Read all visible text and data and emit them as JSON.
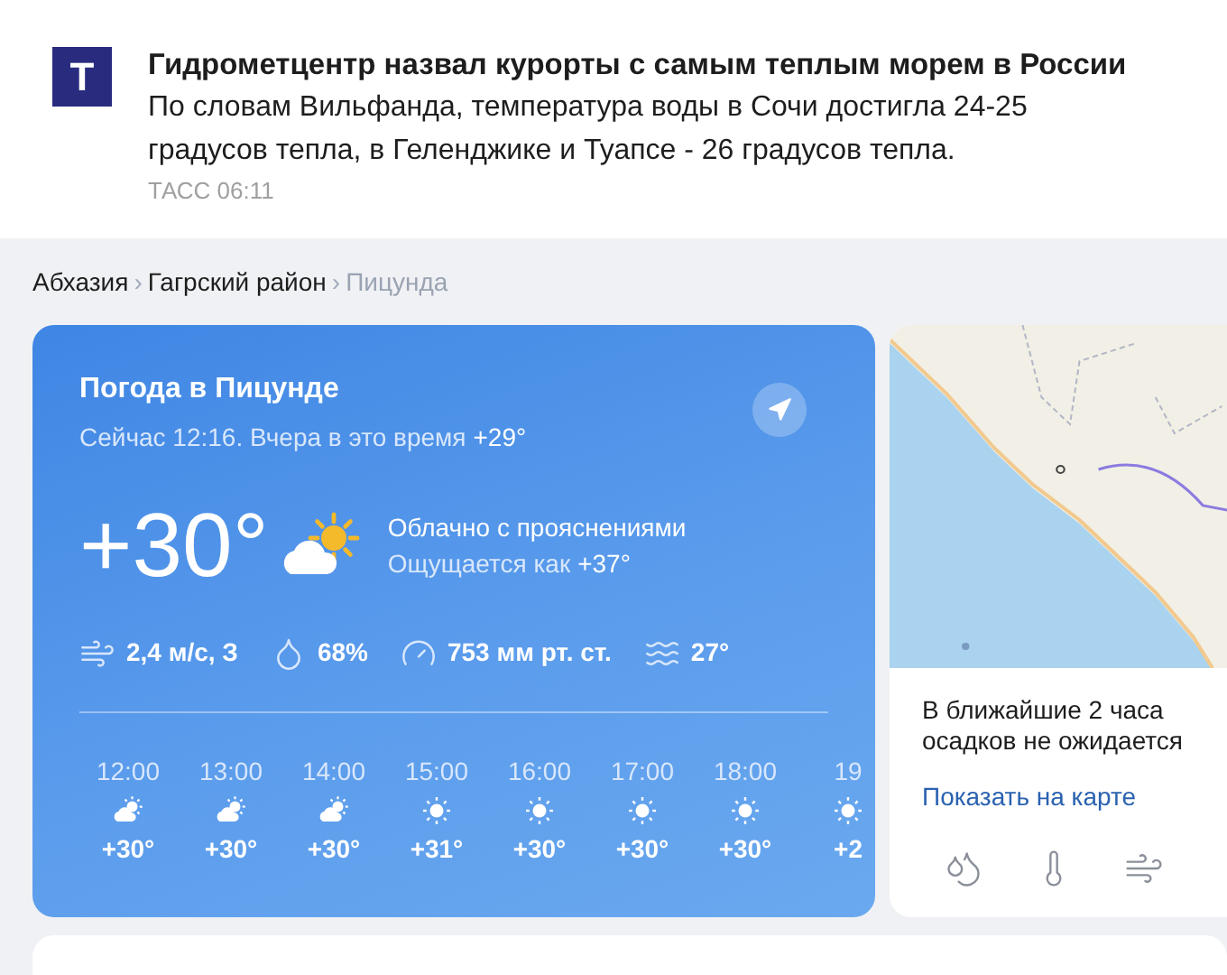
{
  "news": {
    "logo": "Т",
    "title": "Гидрометцентр назвал курорты с самым теплым морем в России",
    "text": "По словам Вильфанда, температура воды в Сочи достигла 24-25 градусов тепла, в Геленджике и Туапсе - 26 градусов тепла.",
    "source": "ТАСС 06:11"
  },
  "breadcrumbs": [
    {
      "label": "Абхазия",
      "current": false
    },
    {
      "separator": "›",
      "label": "Гагрский район",
      "current": false
    },
    {
      "separator": "›",
      "label": "Пицунда",
      "current": true
    }
  ],
  "weather": {
    "title": "Погода в Пицунде",
    "now": "Сейчас 12:16. Вчера в это время",
    "yesterday": "+29°",
    "temp": "+30°",
    "condition": "Облачно с прояснениями",
    "feels_label": "Ощущается как",
    "feels": "+37°",
    "details": [
      {
        "kind": "wind",
        "text": "2,4 м/с, З"
      },
      {
        "kind": "humidity",
        "text": "68%"
      },
      {
        "kind": "pressure",
        "text": "753 мм рт. ст."
      },
      {
        "kind": "water",
        "text": "27°"
      }
    ],
    "hourly": [
      {
        "time": "12:00",
        "kind": "partly",
        "temp": "+30°"
      },
      {
        "time": "13:00",
        "kind": "partly",
        "temp": "+30°"
      },
      {
        "time": "14:00",
        "kind": "partly",
        "temp": "+30°"
      },
      {
        "time": "15:00",
        "kind": "sun",
        "temp": "+31°"
      },
      {
        "time": "16:00",
        "kind": "sun",
        "temp": "+30°"
      },
      {
        "time": "17:00",
        "kind": "sun",
        "temp": "+30°"
      },
      {
        "time": "18:00",
        "kind": "sun",
        "temp": "+30°"
      },
      {
        "time": "19",
        "kind": "sun",
        "temp": "+2"
      }
    ]
  },
  "map_card": {
    "forecast": "В ближайшие 2 часа осадков не ожидается",
    "link": "Показать на карте",
    "layers": [
      {
        "kind": "precipitation"
      },
      {
        "kind": "temperature"
      },
      {
        "kind": "wind"
      }
    ]
  }
}
